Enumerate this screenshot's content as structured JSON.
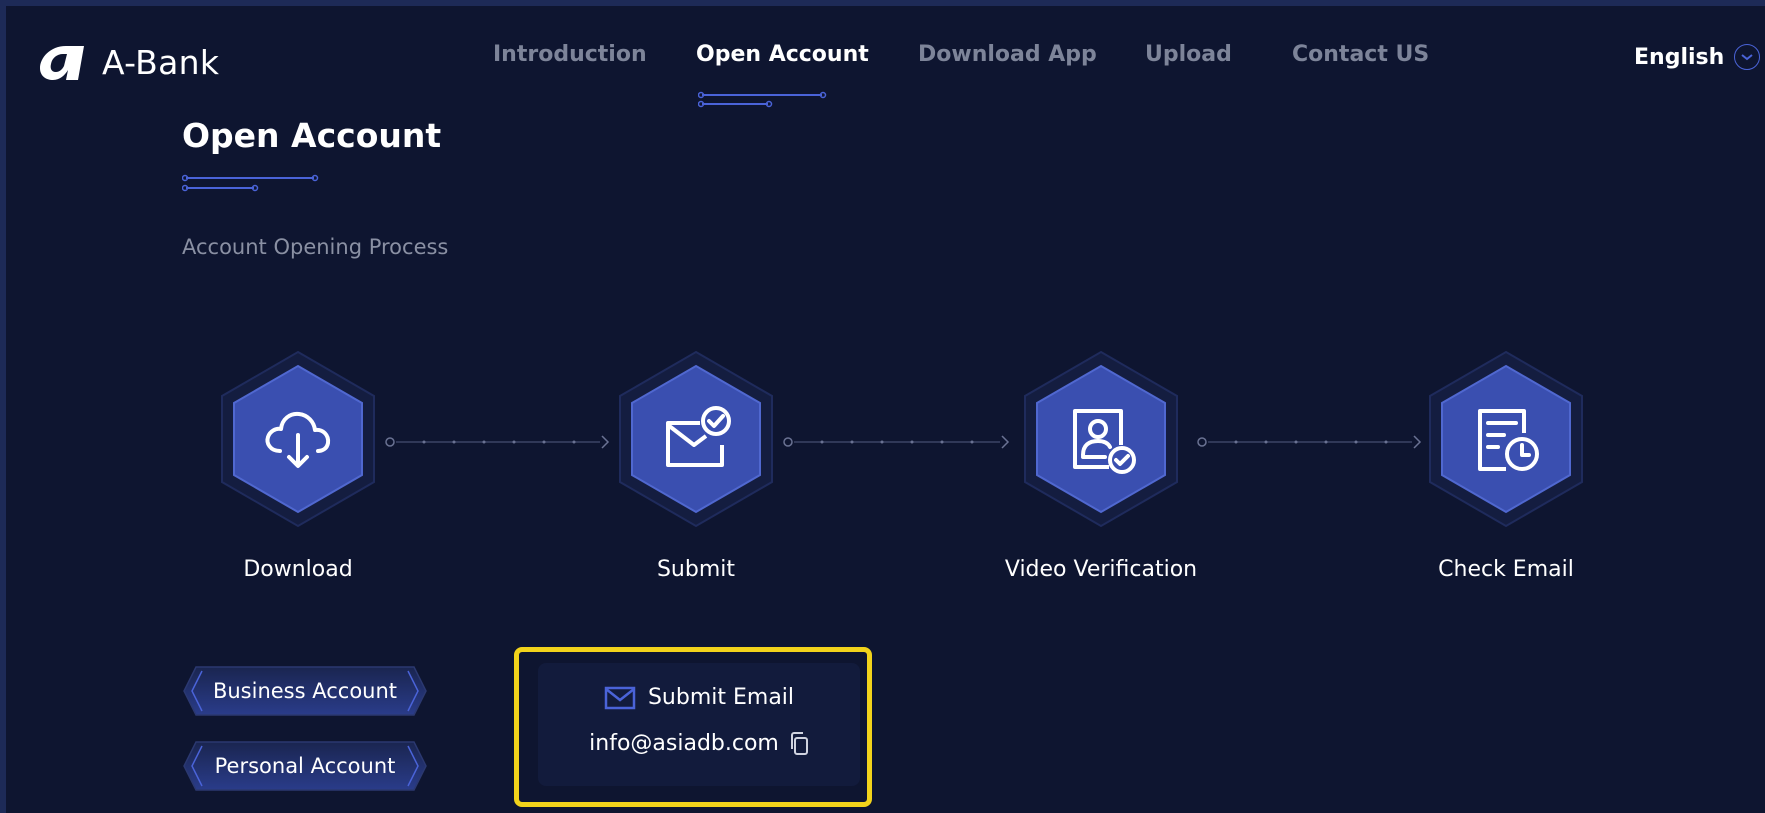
{
  "header": {
    "brand": "A-Bank",
    "nav": [
      {
        "label": "Introduction",
        "active": false
      },
      {
        "label": "Open Account",
        "active": true
      },
      {
        "label": "Download App",
        "active": false
      },
      {
        "label": "Upload",
        "active": false
      },
      {
        "label": "Contact US",
        "active": false
      }
    ],
    "language": "English"
  },
  "page": {
    "title": "Open Account",
    "subtitle": "Account Opening Process"
  },
  "steps": [
    {
      "label": "Download",
      "icon": "cloud-download-icon"
    },
    {
      "label": "Submit",
      "icon": "mail-check-icon"
    },
    {
      "label": "Video Verification",
      "icon": "id-check-icon"
    },
    {
      "label": "Check Email",
      "icon": "document-clock-icon"
    }
  ],
  "account_types": [
    {
      "label": "Business Account"
    },
    {
      "label": "Personal Account"
    }
  ],
  "submit_email": {
    "title": "Submit Email",
    "address": "info@asiadb.com",
    "title_icon": "mail-icon",
    "copy_icon": "copy-icon"
  },
  "colors": {
    "background": "#0e1530",
    "accent": "#4a63d8",
    "hex_fill": "#3a4fb0",
    "highlight": "#f2d31b",
    "muted_text": "#7d8499"
  }
}
